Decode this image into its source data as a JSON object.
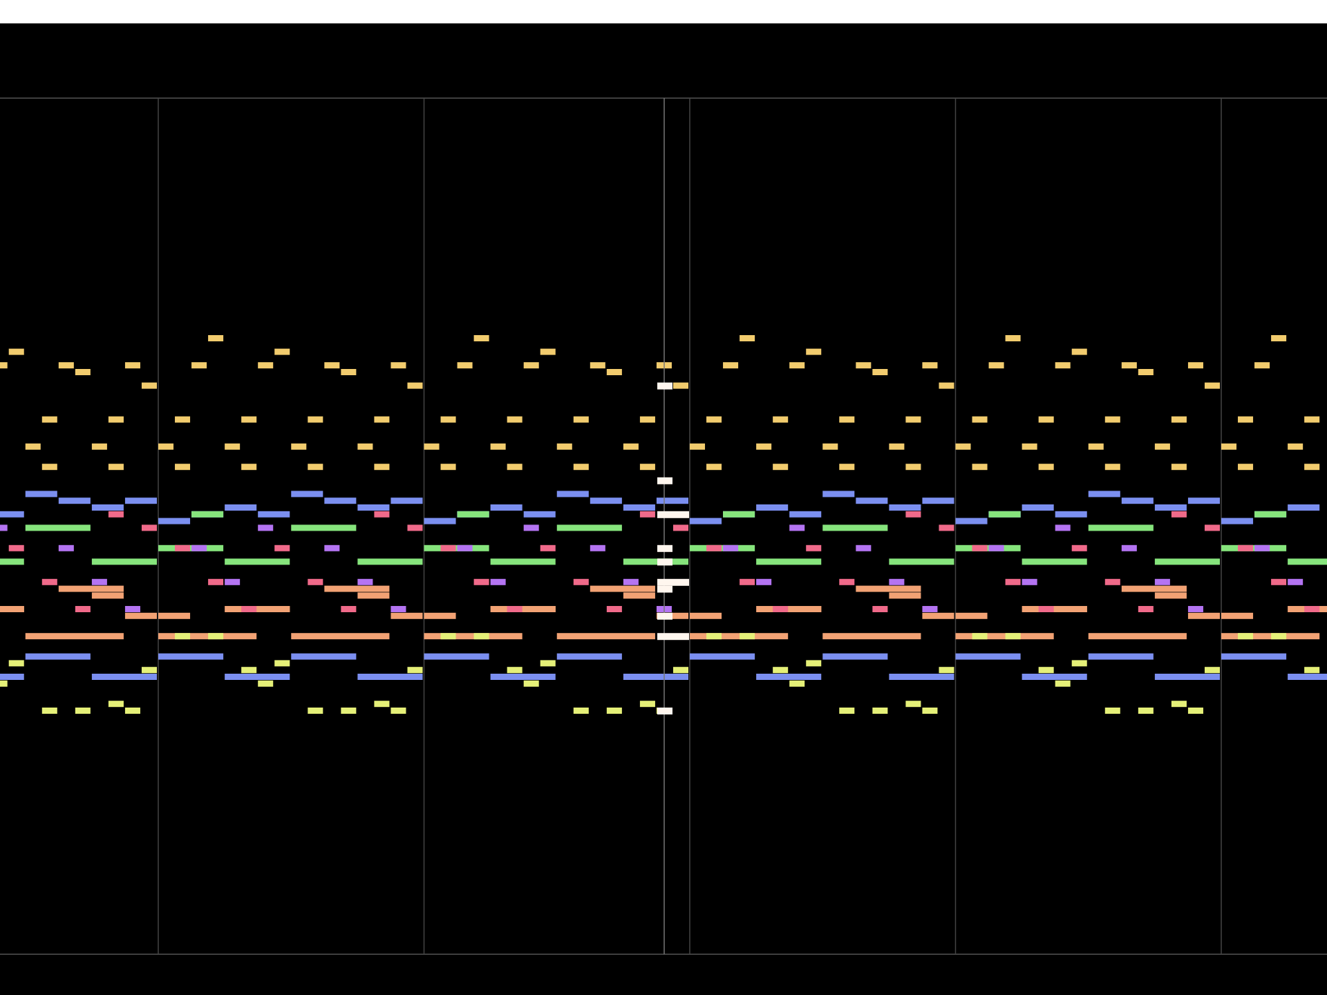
{
  "tracks": [
    {
      "color": "#f2cc6e"
    },
    {
      "color": "#7b8ff0"
    },
    {
      "color": "#86e47c"
    },
    {
      "color": "#f2a274"
    },
    {
      "color": "#e5f078"
    },
    {
      "color": "#f06a8a"
    },
    {
      "color": "#b474f2"
    }
  ]
}
